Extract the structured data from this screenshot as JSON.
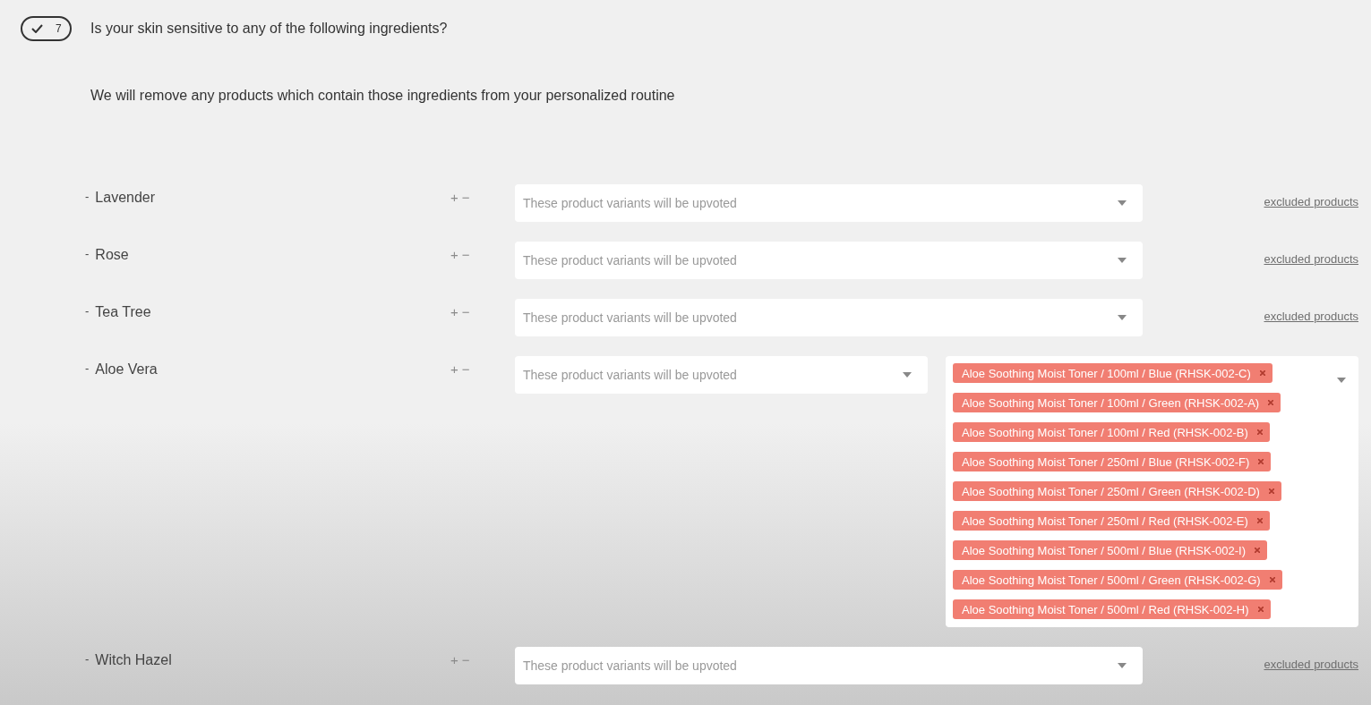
{
  "question": {
    "check": "7",
    "title": "Is your skin sensitive to any of the following ingredients?",
    "description": "We will remove any products which contain those ingredients from your personalized routine"
  },
  "rows": [
    {
      "kind": "link",
      "bullet": "-",
      "name": "Lavender",
      "add": "+",
      "remove": "−",
      "placeholder": "These product variants will be upvoted",
      "link": "excluded products"
    },
    {
      "kind": "link",
      "bullet": "-",
      "name": "Rose",
      "add": "+",
      "remove": "−",
      "placeholder": "These product variants will be upvoted",
      "link": "excluded products"
    },
    {
      "kind": "link",
      "bullet": "-",
      "name": "Tea Tree",
      "add": "+",
      "remove": "−",
      "placeholder": "These product variants will be upvoted",
      "link": "excluded products"
    },
    {
      "kind": "tags",
      "bullet": "-",
      "name": "Aloe Vera",
      "add": "+",
      "remove": "−",
      "placeholder": "These product variants will be upvoted",
      "tags": [
        "Aloe Soothing Moist Toner / 100ml / Blue (RHSK-002-C)",
        "Aloe Soothing Moist Toner / 100ml / Green (RHSK-002-A)",
        "Aloe Soothing Moist Toner / 100ml / Red (RHSK-002-B)",
        "Aloe Soothing Moist Toner / 250ml / Blue (RHSK-002-F)",
        "Aloe Soothing Moist Toner / 250ml / Green (RHSK-002-D)",
        "Aloe Soothing Moist Toner / 250ml / Red (RHSK-002-E)",
        "Aloe Soothing Moist Toner / 500ml / Blue (RHSK-002-I)",
        "Aloe Soothing Moist Toner / 500ml / Green (RHSK-002-G)",
        "Aloe Soothing Moist Toner / 500ml / Red (RHSK-002-H)"
      ]
    },
    {
      "kind": "link",
      "bullet": "-",
      "name": "Witch Hazel",
      "add": "+",
      "remove": "−",
      "placeholder": "These product variants will be upvoted",
      "link": "excluded products"
    }
  ]
}
